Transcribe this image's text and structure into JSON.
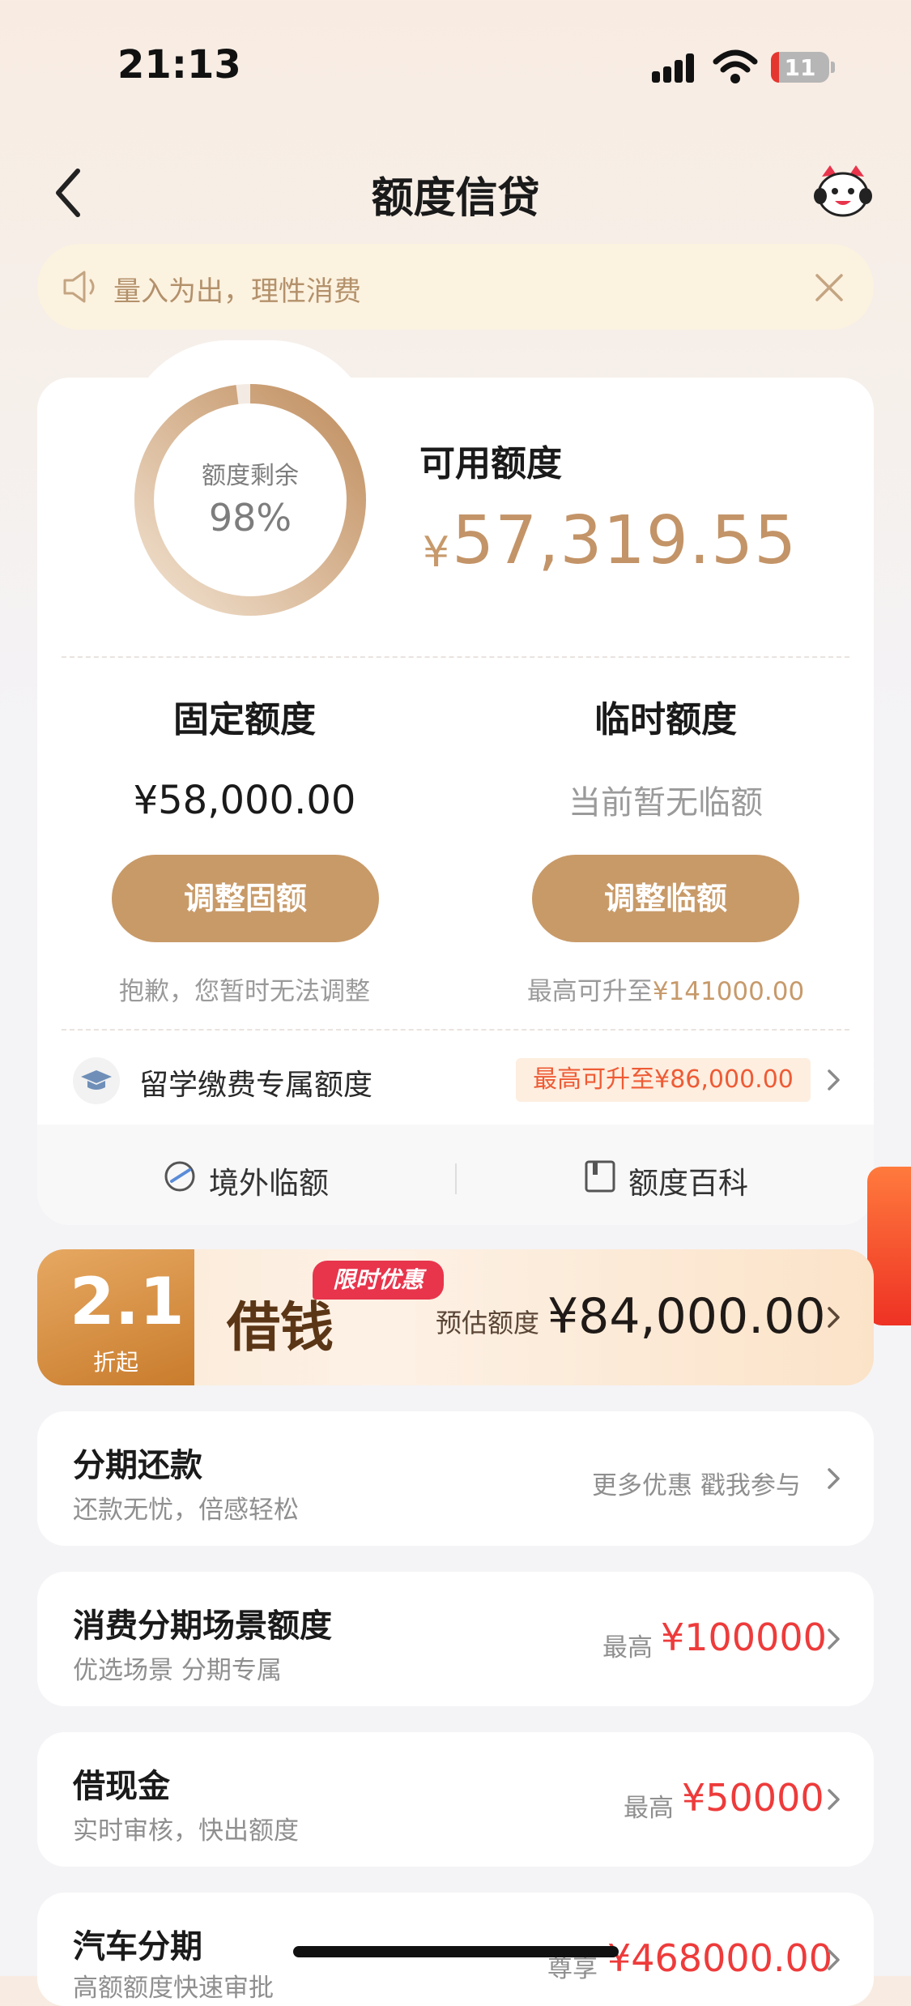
{
  "status_bar": {
    "time": "21:13",
    "battery": "11"
  },
  "nav": {
    "title": "额度信贷"
  },
  "notice": {
    "text": "量入为出，理性消费"
  },
  "credit": {
    "ring_label": "额度剩余",
    "ring_percent": "98%",
    "ring_fraction": 0.98,
    "available_label": "可用额度",
    "currency": "¥",
    "available_amount": "57,319.55"
  },
  "fixed": {
    "title": "固定额度",
    "amount": "¥58,000.00",
    "button": "调整固额",
    "note": "抱歉，您暂时无法调整"
  },
  "temporary": {
    "title": "临时额度",
    "status": "当前暂无临额",
    "button": "调整临额",
    "note_prefix": "最高可升至",
    "note_amount": "¥141000.00"
  },
  "study": {
    "label": "留学缴费专属额度",
    "badge": "最高可升至¥86,000.00"
  },
  "tools": {
    "overseas": "境外临额",
    "wiki": "额度百科"
  },
  "promo": {
    "rate": "2.1",
    "rate_sub": "折起",
    "title": "借钱",
    "tag": "限时优惠",
    "estimate_label": "预估额度",
    "estimate_amount": "¥84,000.00"
  },
  "list": [
    {
      "title": "分期还款",
      "subtitle": "还款无忧，倍感轻松",
      "right_text": "更多优惠 戳我参与"
    },
    {
      "title": "消费分期场景额度",
      "subtitle": "优选场景 分期专属",
      "right_prefix": "最高",
      "right_amount": "¥100000"
    },
    {
      "title": "借现金",
      "subtitle": "实时审核，快出额度",
      "right_prefix": "最高",
      "right_amount": "¥50000"
    },
    {
      "title": "汽车分期",
      "subtitle": "高额额度快速审批",
      "right_prefix": "尊享",
      "right_amount": "¥468000.00"
    }
  ],
  "colors": {
    "gold": "#c89a68",
    "accent_red": "#ee3b3b",
    "orange": "#ee5b35"
  }
}
